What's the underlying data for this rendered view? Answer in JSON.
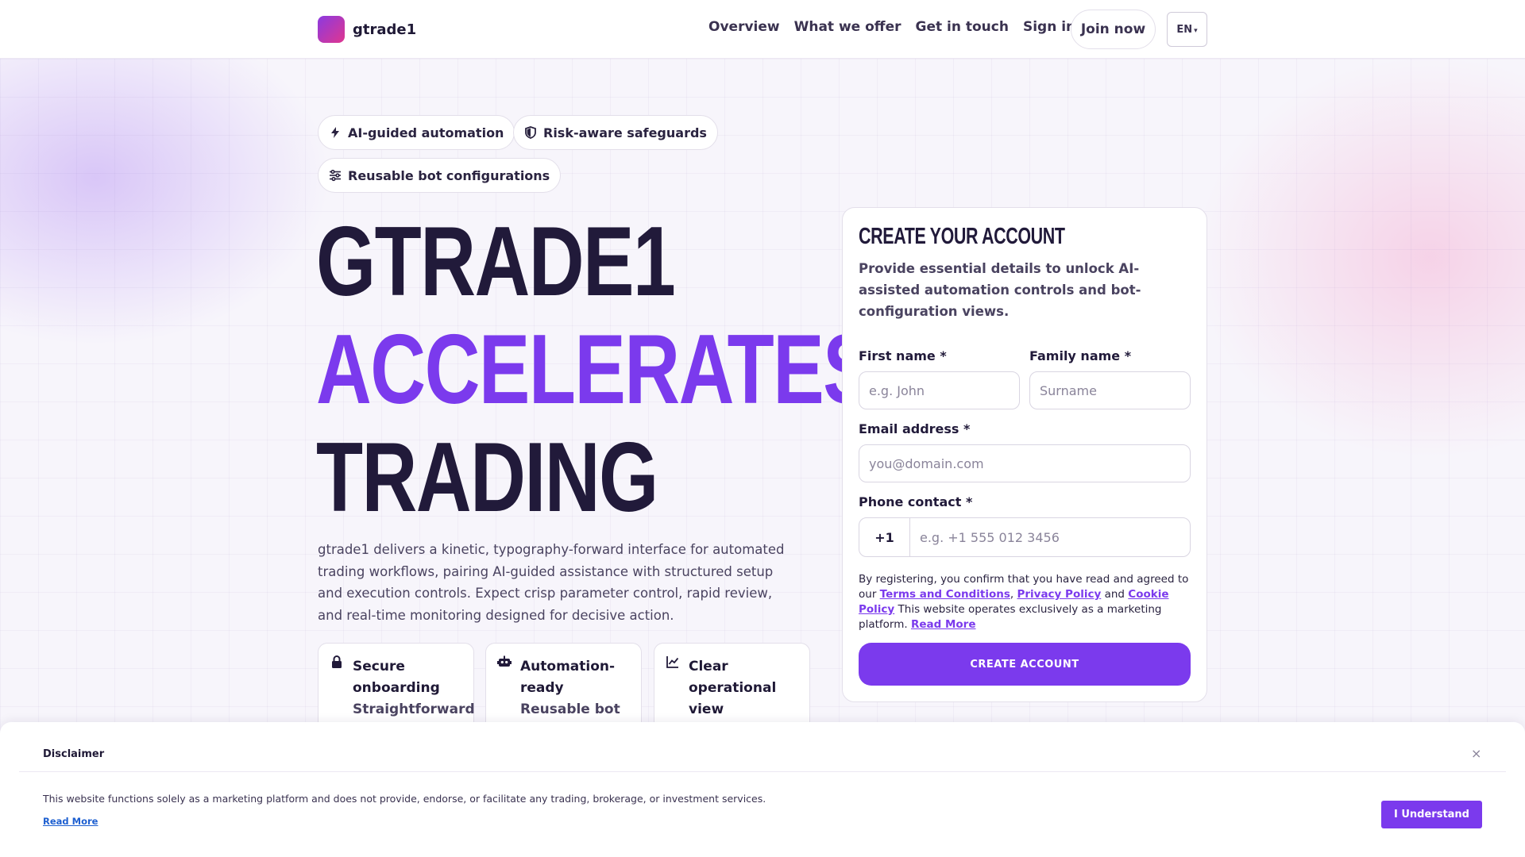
{
  "header": {
    "brand": "gtrade1",
    "nav": [
      "Overview",
      "What we offer",
      "Get in touch",
      "Sign in"
    ],
    "join_label": "Join now",
    "lang_label": "EN"
  },
  "chips": [
    {
      "label": "AI-guided automation",
      "icon": "bolt-icon"
    },
    {
      "label": "Risk-aware safeguards",
      "icon": "shield-icon"
    },
    {
      "label": "Reusable bot configurations",
      "icon": "sliders-icon"
    }
  ],
  "hero": {
    "line1": "GTRADE1",
    "line2": "ACCELERATES",
    "line3": "TRADING",
    "description": "gtrade1 delivers a kinetic, typography-forward interface for automated trading workflows, pairing AI-guided assistance with structured setup and execution controls. Expect crisp parameter control, rapid review, and real-time monitoring designed for decisive action."
  },
  "features": [
    {
      "title": "Secure onboarding",
      "subtitle": "Straightforward",
      "icon": "lock-icon"
    },
    {
      "title": "Automation-ready",
      "subtitle": "Reusable bot",
      "icon": "robot-icon"
    },
    {
      "title": "Clear operational view",
      "subtitle": "",
      "icon": "chart-line-icon"
    }
  ],
  "form": {
    "title": "CREATE YOUR ACCOUNT",
    "subtitle": "Provide essential details to unlock AI-assisted automation controls and bot-configuration views.",
    "first_name_label": "First name *",
    "first_name_placeholder": "e.g. John",
    "family_name_label": "Family name *",
    "family_name_placeholder": "Surname",
    "email_label": "Email address *",
    "email_placeholder": "you@domain.com",
    "phone_label": "Phone contact *",
    "phone_code": "+1",
    "phone_placeholder": "e.g. +1 555 012 3456",
    "legal_prefix": "By registering, you confirm that you have read and agreed to our",
    "terms_link": "Terms and Conditions",
    "comma": ",",
    "privacy_link": "Privacy Policy",
    "and": "and",
    "cookie_link": "Cookie Policy",
    "legal_suffix": "This website operates exclusively as a marketing platform.",
    "read_more_link": "Read More",
    "submit_label": "CREATE ACCOUNT"
  },
  "disclaimer": {
    "title": "Disclaimer",
    "close_glyph": "×",
    "text": "This website functions solely as a marketing platform and does not provide, endorse, or facilitate any trading, brokerage, or investment services.",
    "read_more": "Read More",
    "button_label": "I Understand"
  },
  "colors": {
    "accent": "#7b3aed",
    "heading_dark": "#211a3a",
    "link_blue": "#1d5fd0"
  }
}
